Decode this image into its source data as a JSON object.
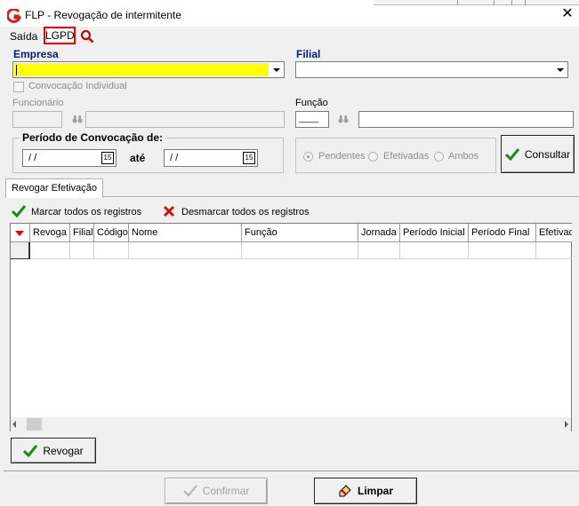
{
  "window": {
    "title": "FLP - Revogação de intermitente",
    "close_glyph": "✕",
    "app_icon": "g-logo-icon"
  },
  "menu": {
    "saida": "Saída",
    "lgpd": "LGPD",
    "search_icon": "magnifier-icon"
  },
  "filters": {
    "empresa_label": "Empresa",
    "empresa_value": "",
    "empresa_highlight": "#ffff00",
    "filial_label": "Filial",
    "filial_value": "",
    "convocacao_individual_label": "Convocação Individual",
    "funcionario_label": "Funcionário",
    "funcao_label": "Função",
    "funcao_code": "____"
  },
  "periodo": {
    "title": "Período de Convocação de:",
    "start_value": " / /",
    "ate_label": "até",
    "end_value": " / /",
    "calendar_glyph": "15"
  },
  "status": {
    "options": [
      "Pendentes",
      "Efetivadas",
      "Ambos"
    ],
    "selected": "Pendentes"
  },
  "buttons": {
    "consultar": "Consultar",
    "revogar": "Revogar",
    "confirmar": "Confirmar",
    "limpar": "Limpar"
  },
  "tabs": [
    "Revogar Efetivação"
  ],
  "actions": {
    "marcar": "Marcar todos os registros",
    "desmarcar": "Desmarcar todos os registros"
  },
  "grid": {
    "columns": [
      "Revoga",
      "Filial",
      "Código",
      "Nome",
      "Função",
      "Jornada",
      "Período Inicial",
      "Período Final",
      "Efetivado"
    ]
  },
  "colors": {
    "label_blue": "#002080",
    "check_green": "#1a8a1a",
    "cross_red": "#c81414",
    "lgpd_border": "#e00000"
  }
}
